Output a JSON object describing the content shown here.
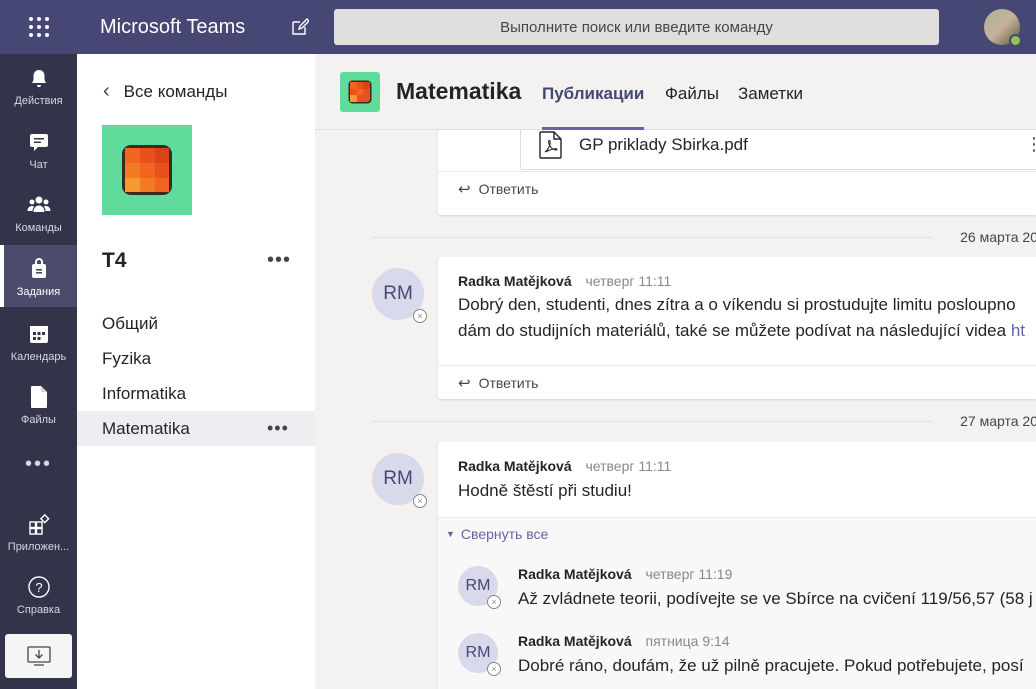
{
  "app": {
    "title": "Microsoft Teams"
  },
  "search": {
    "placeholder": "Выполните поиск или введите команду"
  },
  "rail": {
    "items": [
      {
        "label": "Действия",
        "icon": "bell-icon"
      },
      {
        "label": "Чат",
        "icon": "chat-icon"
      },
      {
        "label": "Команды",
        "icon": "teams-icon"
      },
      {
        "label": "Задания",
        "icon": "assignments-icon",
        "active": true
      },
      {
        "label": "Календарь",
        "icon": "calendar-icon"
      },
      {
        "label": "Файлы",
        "icon": "files-icon"
      },
      {
        "label": "Приложен...",
        "icon": "apps-icon"
      },
      {
        "label": "Справка",
        "icon": "help-icon"
      }
    ],
    "more": "•••"
  },
  "panel": {
    "back_label": "Все команды",
    "team_name": "T4",
    "more": "•••",
    "channels": [
      {
        "label": "Общий"
      },
      {
        "label": "Fyzika"
      },
      {
        "label": "Informatika"
      },
      {
        "label": "Matematika",
        "active": true
      }
    ]
  },
  "channel": {
    "title": "Matematika",
    "tabs": [
      {
        "label": "Публикации",
        "active": true
      },
      {
        "label": "Файлы"
      },
      {
        "label": "Заметки"
      }
    ]
  },
  "feed": {
    "file_card": {
      "filename": "GP priklady Sbirka.pdf",
      "reply": "Ответить"
    },
    "dates": [
      "26 марта 20…",
      "27 марта 20…"
    ],
    "post1": {
      "initials": "RM",
      "author": "Radka Matějková",
      "time": "четверг 11:11",
      "line1": "Dobrý den, studenti, dnes zítra a o víkendu si prostudujte limitu posloupno",
      "line2": "dám do studijních materiálů, také se můžete podívat na následující videa",
      "link": "ht",
      "reply": "Ответить"
    },
    "post2": {
      "initials": "RM",
      "author": "Radka Matějková",
      "time": "четверг 11:11",
      "body": "Hodně štěstí při studiu!",
      "collapse": "Свернуть все",
      "replies": [
        {
          "initials": "RM",
          "author": "Radka Matějková",
          "time": "четверг 11:19",
          "body": "Až zvládnete teorii, podívejte se ve Sbírce na cvičení 119/56,57 (58 j"
        },
        {
          "initials": "RM",
          "author": "Radka Matějková",
          "time": "пятница 9:14",
          "body": "Dobré ráno, doufám, že už pilně pracujete. Pokud potřebujete, posí"
        }
      ]
    }
  },
  "colors": {
    "topbar": "#464775",
    "rail": "#33344a",
    "accent": "#6264a7",
    "team_tile": "#5fdb9b"
  }
}
